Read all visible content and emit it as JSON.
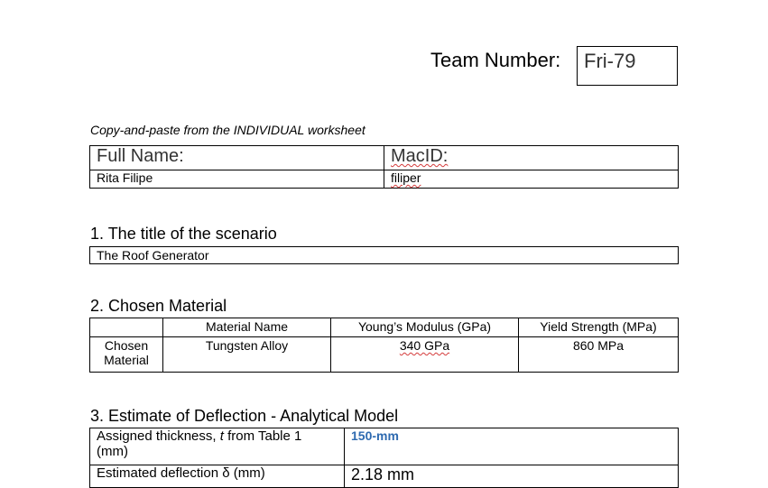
{
  "team": {
    "label": "Team Number:",
    "value": "Fri-79"
  },
  "caption": "Copy-and-paste from the INDIVIDUAL worksheet",
  "name_table": {
    "full_name_label": "Full Name:",
    "macid_label": "MacID:",
    "full_name": "Rita Filipe",
    "macid": "filiper"
  },
  "sections": [
    {
      "heading": "1.  The title of the scenario"
    },
    {
      "heading": "2.  Chosen Material"
    },
    {
      "heading": "3.  Estimate of Deflection - Analytical Model"
    }
  ],
  "scenario_title": "The Roof Generator",
  "material_table": {
    "headers": [
      "",
      "Material Name",
      "Young’s Modulus (GPa)",
      "Yield Strength (MPa)"
    ],
    "row_label_line1": "Chosen",
    "row_label_line2": "Material",
    "material_name": "Tungsten Alloy",
    "youngs_modulus": "340 GPa",
    "yield_strength": "860 MPa"
  },
  "estimate_table": {
    "thickness_label_pre": "Assigned thickness, ",
    "thickness_label_var": "t",
    "thickness_label_post": " from Table 1",
    "thickness_label_line2": "(mm)",
    "thickness_value": "150-mm",
    "deflection_label": "Estimated deflection δ (mm)",
    "deflection_value": "2.18 mm"
  },
  "colors": {
    "accent_blue": "#2e6ab0",
    "spell_underline": "#d43b3b"
  }
}
